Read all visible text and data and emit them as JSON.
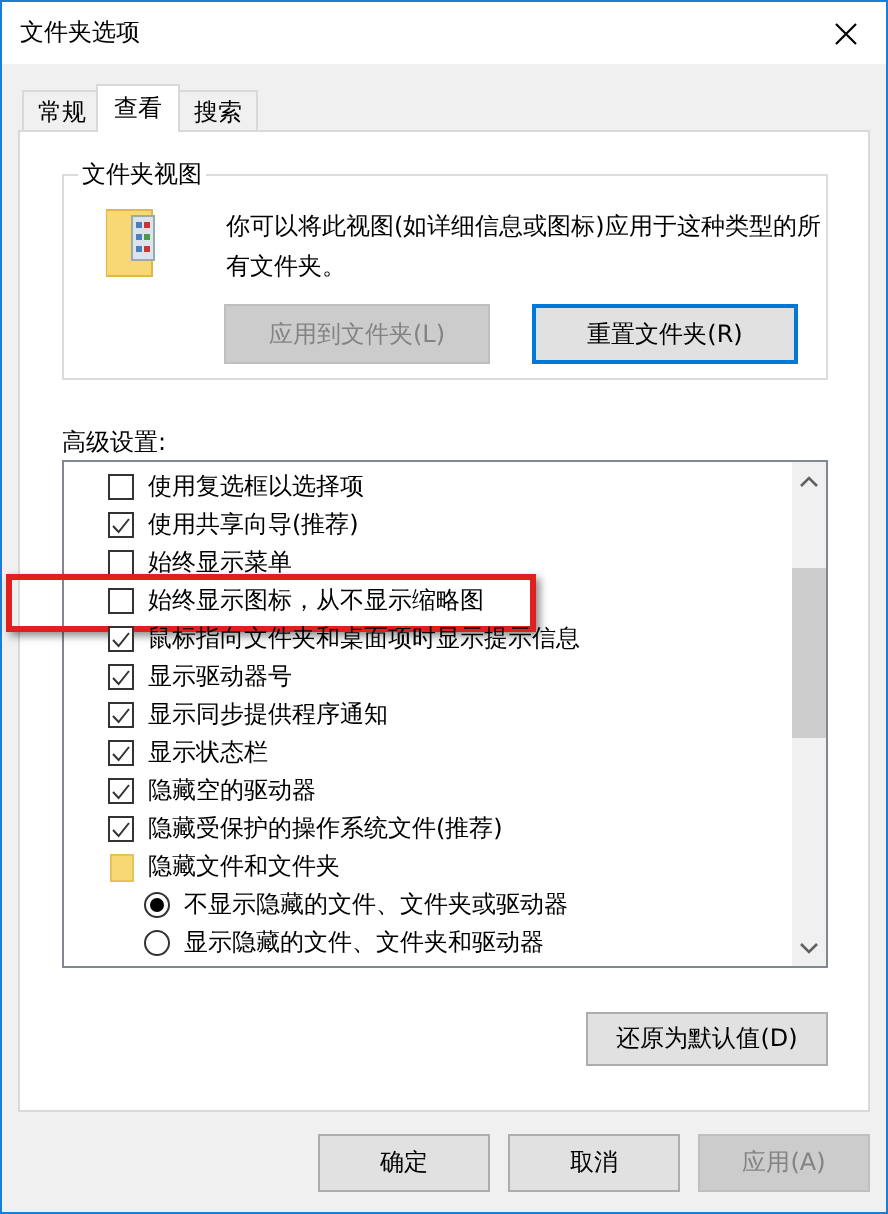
{
  "window": {
    "title": "文件夹选项"
  },
  "tabs": [
    {
      "label": "常规",
      "selected": false
    },
    {
      "label": "查看",
      "selected": true
    },
    {
      "label": "搜索",
      "selected": false
    }
  ],
  "folder_view": {
    "title": "文件夹视图",
    "description": "你可以将此视图(如详细信息或图标)应用于这种类型的所有文件夹。",
    "buttons": [
      {
        "label": "应用到文件夹(L)",
        "disabled": true,
        "focused": false
      },
      {
        "label": "重置文件夹(R)",
        "disabled": false,
        "focused": true
      }
    ]
  },
  "advanced": {
    "label": "高级设置:",
    "items": [
      {
        "kind": "checkbox",
        "label": "使用复选框以选择项",
        "checked": false,
        "highlighted": false
      },
      {
        "kind": "checkbox",
        "label": "使用共享向导(推荐)",
        "checked": true,
        "highlighted": false
      },
      {
        "kind": "checkbox",
        "label": "始终显示菜单",
        "checked": false,
        "highlighted": false
      },
      {
        "kind": "checkbox",
        "label": "始终显示图标，从不显示缩略图",
        "checked": false,
        "highlighted": true
      },
      {
        "kind": "checkbox",
        "label": "鼠标指向文件夹和桌面项时显示提示信息",
        "checked": true,
        "highlighted": false
      },
      {
        "kind": "checkbox",
        "label": "显示驱动器号",
        "checked": true,
        "highlighted": false
      },
      {
        "kind": "checkbox",
        "label": "显示同步提供程序通知",
        "checked": true,
        "highlighted": false
      },
      {
        "kind": "checkbox",
        "label": "显示状态栏",
        "checked": true,
        "highlighted": false
      },
      {
        "kind": "checkbox",
        "label": "隐藏空的驱动器",
        "checked": true,
        "highlighted": false
      },
      {
        "kind": "checkbox",
        "label": "隐藏受保护的操作系统文件(推荐)",
        "checked": true,
        "highlighted": false
      },
      {
        "kind": "folder",
        "label": "隐藏文件和文件夹",
        "children": [
          {
            "kind": "radio",
            "label": "不显示隐藏的文件、文件夹或驱动器",
            "selected": true
          },
          {
            "kind": "radio",
            "label": "显示隐藏的文件、文件夹和驱动器",
            "selected": false
          }
        ]
      }
    ]
  },
  "restore_button": {
    "label": "还原为默认值(D)"
  },
  "buttons": [
    {
      "label": "确定",
      "disabled": false
    },
    {
      "label": "取消",
      "disabled": false
    },
    {
      "label": "应用(A)",
      "disabled": true
    }
  ]
}
